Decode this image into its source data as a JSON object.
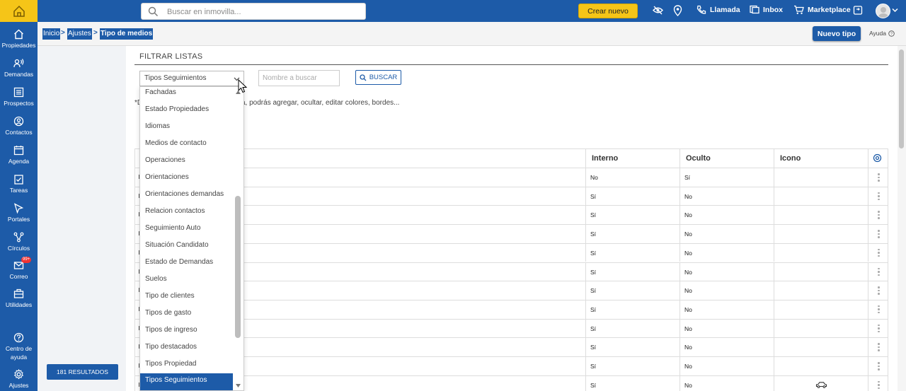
{
  "topbar": {
    "search_placeholder": "Buscar en inmovilla...",
    "crear_label": "Crear nuevo",
    "llamada_label": "Llamada",
    "inbox_label": "Inbox",
    "marketplace_label": "Marketplace"
  },
  "sidebar": {
    "items": [
      {
        "label": "Propiedades",
        "icon": "home-icon"
      },
      {
        "label": "Demandas",
        "icon": "demand-icon"
      },
      {
        "label": "Prospectos",
        "icon": "prospect-icon"
      },
      {
        "label": "Contactos",
        "icon": "contact-icon"
      },
      {
        "label": "Agenda",
        "icon": "calendar-icon"
      },
      {
        "label": "Tareas",
        "icon": "task-icon"
      },
      {
        "label": "Portales",
        "icon": "cursor-icon"
      },
      {
        "label": "Círculos",
        "icon": "share-icon"
      },
      {
        "label": "Correo",
        "icon": "mail-icon",
        "badge": "99+"
      },
      {
        "label": "Utilidades",
        "icon": "briefcase-icon"
      }
    ],
    "help_label_1": "Centro de",
    "help_label_2": "ayuda",
    "settings_label": "Ajustes"
  },
  "breadcrumb": {
    "items": [
      "Inicio",
      "Ajustes",
      "Tipo de medios"
    ],
    "separator": ">"
  },
  "header": {
    "new_type_label": "Nuevo tipo",
    "help_label": "Ayuda"
  },
  "results": {
    "label": "181 RESULTADOS"
  },
  "filter": {
    "title": "FILTRAR LISTAS",
    "select_value": "Tipos Seguimientos",
    "name_placeholder": "Nombre a buscar",
    "search_label": "BUSCAR",
    "note_left": "*D",
    "note_right": "a, podrás agregar, ocultar, editar colores, bordes..."
  },
  "table": {
    "headers": [
      "Interno",
      "Oculto",
      "Icono"
    ],
    "rows": [
      {
        "interno": "No",
        "oculto": "Sí",
        "icono": ""
      },
      {
        "interno": "Sí",
        "oculto": "No",
        "icono": ""
      },
      {
        "interno": "Sí",
        "oculto": "No",
        "icono": ""
      },
      {
        "interno": "Sí",
        "oculto": "No",
        "icono": ""
      },
      {
        "interno": "Sí",
        "oculto": "No",
        "icono": ""
      },
      {
        "interno": "Sí",
        "oculto": "No",
        "icono": ""
      },
      {
        "interno": "Sí",
        "oculto": "No",
        "icono": ""
      },
      {
        "interno": "Sí",
        "oculto": "No",
        "icono": ""
      },
      {
        "interno": "Sí",
        "oculto": "No",
        "icono": ""
      },
      {
        "interno": "Sí",
        "oculto": "No",
        "icono": ""
      },
      {
        "interno": "Sí",
        "oculto": "No",
        "icono": ""
      },
      {
        "interno": "Sí",
        "oculto": "No",
        "icono": "car-icon"
      }
    ]
  },
  "dropdown": {
    "items": [
      "Fachadas",
      "Estado Propiedades",
      "Idiomas",
      "Medios de contacto",
      "Operaciones",
      "Orientaciones",
      "Orientaciones demandas",
      "Relacion contactos",
      "Seguimiento Auto",
      "Situación Candidato",
      "Estado de Demandas",
      "Suelos",
      "Tipo de clientes",
      "Tipos de gasto",
      "Tipos de ingreso",
      "Tipo destacados",
      "Tipos Propiedad",
      "Tipos Seguimientos"
    ],
    "selected_index": 17
  },
  "colors": {
    "brand_blue": "#1d5ba8",
    "accent_yellow": "#f5c518"
  }
}
